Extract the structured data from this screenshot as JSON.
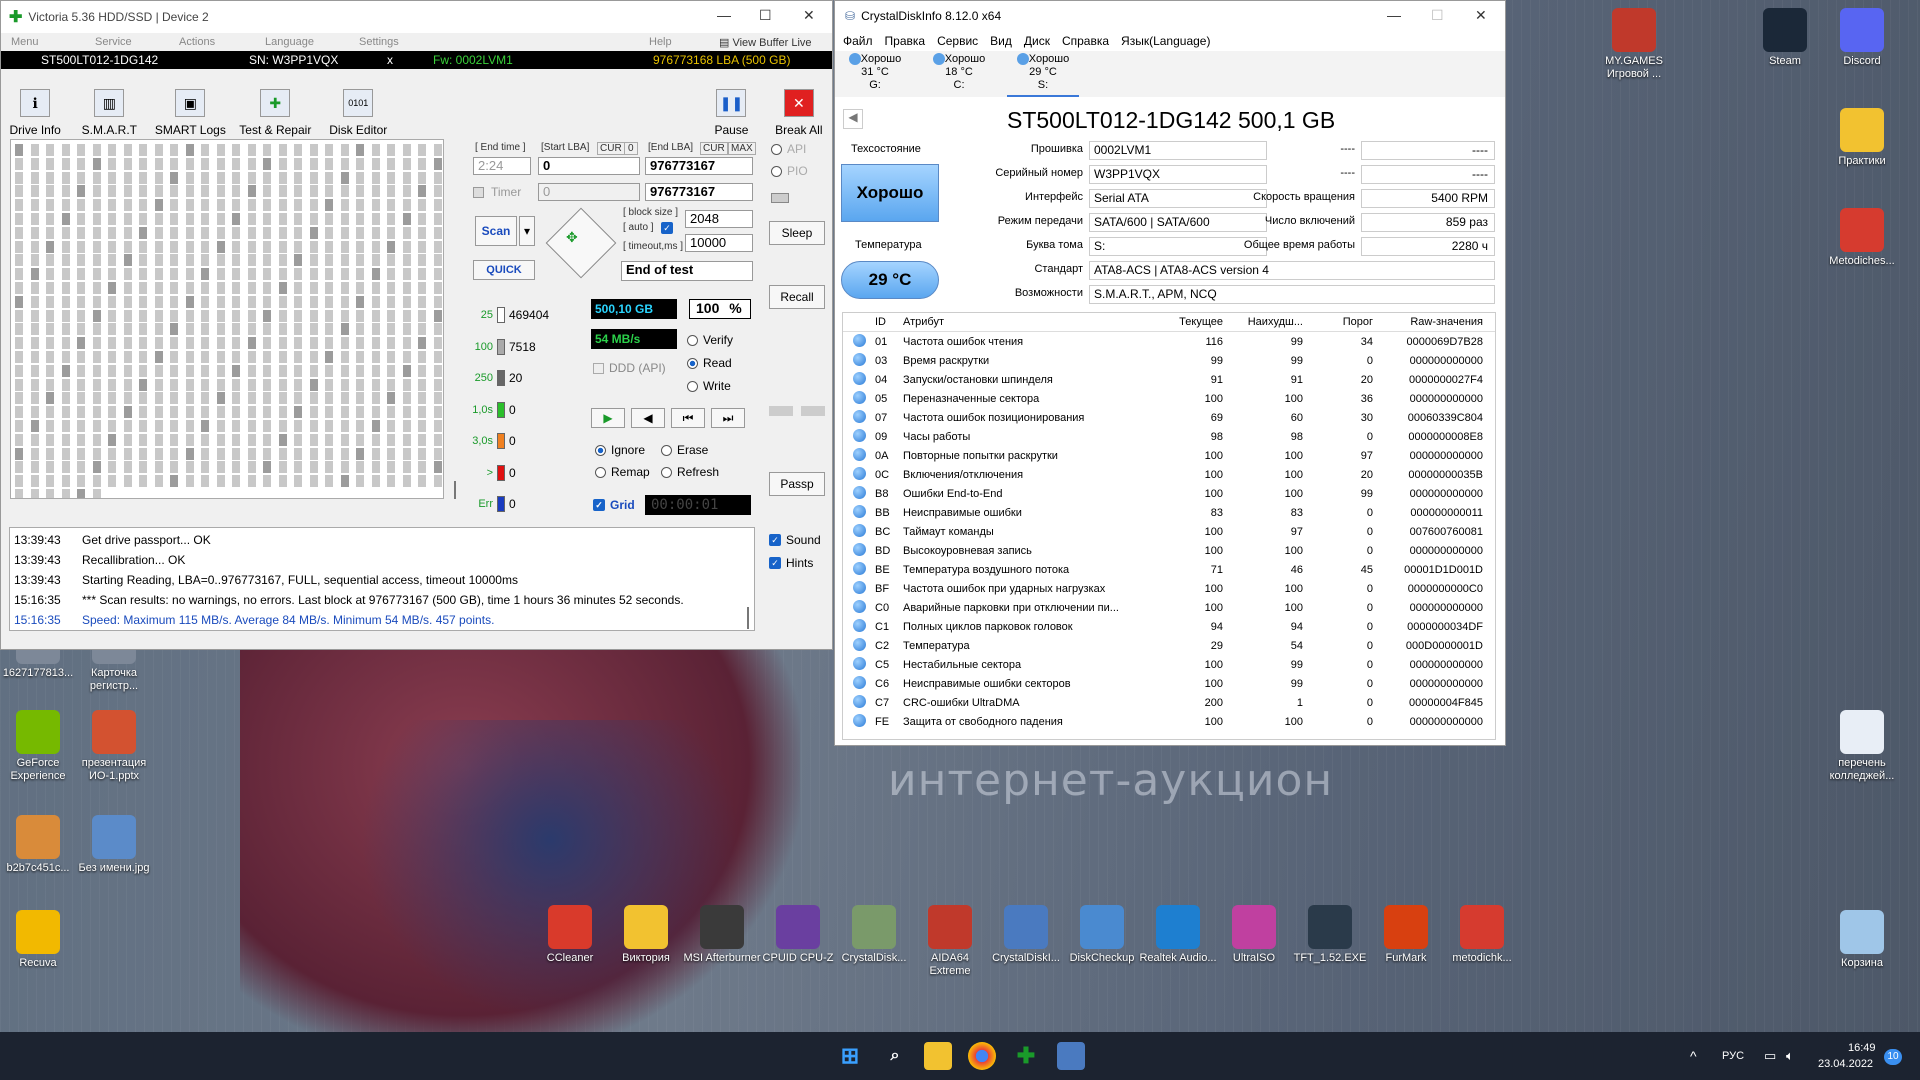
{
  "desktop": {
    "watermark": "интернет-аукцион",
    "icons_right": [
      {
        "label": "MY.GAMES Игровой ...",
        "color": "#c0392b"
      },
      {
        "label": "Steam",
        "color": "#1b2838"
      },
      {
        "label": "Discord",
        "color": "#5865f2"
      },
      {
        "label": "Практики",
        "color": "#f2c230"
      },
      {
        "label": "Metodiches...",
        "color": "#d63b2f"
      },
      {
        "label": "перечень колледжей...",
        "color": "#e8eef6"
      },
      {
        "label": "Корзина",
        "color": "#9fc6e8"
      }
    ],
    "icons_left": [
      {
        "label": "1627177813...",
        "color": "#7d8898"
      },
      {
        "label": "Карточка регистр...",
        "color": "#7d8898"
      },
      {
        "label": "GeForce Experience",
        "color": "#76b900"
      },
      {
        "label": "презентация ИО-1.pptx",
        "color": "#d35230"
      },
      {
        "label": "b2b7c451c...",
        "color": "#d98b3a"
      },
      {
        "label": "Без имени.jpg",
        "color": "#5b8bc9"
      },
      {
        "label": "Recuva",
        "color": "#f2b900"
      }
    ],
    "icons_bottom": [
      {
        "label": "CCleaner",
        "color": "#d93a2b"
      },
      {
        "label": "Виктория",
        "color": "#f2c230"
      },
      {
        "label": "MSI Afterburner",
        "color": "#3a3a3a"
      },
      {
        "label": "CPUID CPU-Z",
        "color": "#6a3fa0"
      },
      {
        "label": "CrystalDisk...",
        "color": "#7a9a6a"
      },
      {
        "label": "AIDA64 Extreme",
        "color": "#c0392b"
      },
      {
        "label": "CrystalDiskI...",
        "color": "#4a7ac0"
      },
      {
        "label": "DiskCheckup",
        "color": "#4a8ad0"
      },
      {
        "label": "Realtek Audio...",
        "color": "#1e7fd0"
      },
      {
        "label": "UltraISO",
        "color": "#c040a0"
      },
      {
        "label": "TFT_1.52.EXE",
        "color": "#2a3a4a"
      },
      {
        "label": "FurMark",
        "color": "#d84010"
      },
      {
        "label": "metodichk...",
        "color": "#d63b2f"
      }
    ]
  },
  "victoria": {
    "title": "Victoria 5.36 HDD/SSD | Device 2",
    "menu": [
      "Menu",
      "Service",
      "Actions",
      "Language",
      "Settings",
      "Help"
    ],
    "view_buffer": "View Buffer Live",
    "model": "ST500LT012-1DG142",
    "serial": "SN: W3PP1VQX",
    "close_x": "x",
    "firmware": "Fw: 0002LVM1",
    "lba": "976773168 LBA (500 GB)",
    "toolbar": [
      "Drive Info",
      "S.M.A.R.T",
      "SMART Logs",
      "Test & Repair",
      "Disk Editor"
    ],
    "pause": "Pause",
    "break_all": "Break All",
    "end_time_lbl": "[ End time ]",
    "start_lba_lbl": "[Start LBA]",
    "cur": "CUR",
    "zero": "0",
    "end_lba_lbl": "[End LBA]",
    "max": "MAX",
    "end_time": "2:24",
    "start_lba": "0",
    "end_lba": "976773167",
    "timer_lbl": "Timer",
    "timer_val": "0",
    "end_lba2": "976773167",
    "scan": "Scan",
    "quick": "QUICK",
    "block_size_lbl": "[ block size ]",
    "auto_lbl": "[ auto ]",
    "block_size": "2048",
    "timeout_lbl": "[ timeout,ms ]",
    "timeout": "10000",
    "end_of_test": "End of test",
    "api": "API",
    "pio": "PIO",
    "sleep": "Sleep",
    "recall": "Recall",
    "passp": "Passp",
    "counters": [
      {
        "label": "25",
        "value": "469404",
        "color": "#ffffff"
      },
      {
        "label": "100",
        "value": "7518",
        "color": "#aaaaaa"
      },
      {
        "label": "250",
        "value": "20",
        "color": "#666666"
      },
      {
        "label": "1,0s",
        "value": "0",
        "color": "#2bbf2b"
      },
      {
        "label": "3,0s",
        "value": "0",
        "color": "#f08020"
      },
      {
        "label": ">",
        "value": "0",
        "color": "#e01010"
      },
      {
        "label": "Err",
        "value": "0",
        "color": "#1a3cc0"
      }
    ],
    "size": "500,10 GB",
    "percent": "100",
    "percent_sign": "%",
    "speed": "54 MB/s",
    "ddd": "DDD (API)",
    "verify": "Verify",
    "read": "Read",
    "write": "Write",
    "ignore": "Ignore",
    "erase": "Erase",
    "remap": "Remap",
    "refresh": "Refresh",
    "grid": "Grid",
    "clock": "00:00:01",
    "sound": "Sound",
    "hints": "Hints",
    "log": [
      {
        "time": "13:39:43",
        "text": "Get drive passport... OK",
        "blue": false
      },
      {
        "time": "13:39:43",
        "text": "Recallibration... OK",
        "blue": false
      },
      {
        "time": "13:39:43",
        "text": "Starting Reading, LBA=0..976773167, FULL, sequential access, timeout 10000ms",
        "blue": false
      },
      {
        "time": "15:16:35",
        "text": "*** Scan results: no warnings, no errors. Last block at 976773167 (500 GB), time 1 hours 36 minutes 52 seconds.",
        "blue": false
      },
      {
        "time": "15:16:35",
        "text": "Speed: Maximum 115 MB/s. Average 84 MB/s. Minimum 54 MB/s. 457 points.",
        "blue": true
      }
    ]
  },
  "crystal": {
    "title": "CrystalDiskInfo 8.12.0 x64",
    "menu": [
      "Файл",
      "Правка",
      "Сервис",
      "Вид",
      "Диск",
      "Справка",
      "Язык(Language)"
    ],
    "disks": [
      {
        "status": "Хорошо",
        "temp": "31 °C",
        "letter": "G:"
      },
      {
        "status": "Хорошо",
        "temp": "18 °C",
        "letter": "C:"
      },
      {
        "status": "Хорошо",
        "temp": "29 °C",
        "letter": "S:"
      }
    ],
    "drive_title": "ST500LT012-1DG142 500,1 GB",
    "health_lbl": "Техсостояние",
    "health": "Хорошо",
    "temp_lbl": "Температура",
    "temp": "29 °C",
    "fw_lbl": "Прошивка",
    "fw": "0002LVM1",
    "sn_lbl": "Серийный номер",
    "sn": "W3PP1VQX",
    "iface_lbl": "Интерфейс",
    "iface": "Serial ATA",
    "mode_lbl": "Режим передачи",
    "mode": "SATA/600 | SATA/600",
    "letter_lbl": "Буква тома",
    "letter": "S:",
    "std_lbl": "Стандарт",
    "std": "ATA8-ACS | ATA8-ACS version 4",
    "feat_lbl": "Возможности",
    "feat": "S.M.A.R.T., APM, NCQ",
    "dash": "----",
    "rpm_lbl": "Скорость вращения",
    "rpm": "5400 RPM",
    "pc_lbl": "Число включений",
    "pc": "859 раз",
    "hours_lbl": "Общее время работы",
    "hours": "2280 ч",
    "headers": {
      "id": "ID",
      "attr": "Атрибут",
      "cur": "Текущее",
      "worst": "Наихудш...",
      "thr": "Порог",
      "raw": "Raw-значения"
    },
    "rows": [
      {
        "id": "01",
        "name": "Частота ошибок чтения",
        "cur": "116",
        "worst": "99",
        "thr": "34",
        "raw": "0000069D7B28"
      },
      {
        "id": "03",
        "name": "Время раскрутки",
        "cur": "99",
        "worst": "99",
        "thr": "0",
        "raw": "000000000000"
      },
      {
        "id": "04",
        "name": "Запуски/остановки шпинделя",
        "cur": "91",
        "worst": "91",
        "thr": "20",
        "raw": "0000000027F4"
      },
      {
        "id": "05",
        "name": "Переназначенные сектора",
        "cur": "100",
        "worst": "100",
        "thr": "36",
        "raw": "000000000000"
      },
      {
        "id": "07",
        "name": "Частота ошибок позиционирования",
        "cur": "69",
        "worst": "60",
        "thr": "30",
        "raw": "00060339C804"
      },
      {
        "id": "09",
        "name": "Часы работы",
        "cur": "98",
        "worst": "98",
        "thr": "0",
        "raw": "0000000008E8"
      },
      {
        "id": "0A",
        "name": "Повторные попытки раскрутки",
        "cur": "100",
        "worst": "100",
        "thr": "97",
        "raw": "000000000000"
      },
      {
        "id": "0C",
        "name": "Включения/отключения",
        "cur": "100",
        "worst": "100",
        "thr": "20",
        "raw": "00000000035B"
      },
      {
        "id": "B8",
        "name": "Ошибки End-to-End",
        "cur": "100",
        "worst": "100",
        "thr": "99",
        "raw": "000000000000"
      },
      {
        "id": "BB",
        "name": "Неисправимые ошибки",
        "cur": "83",
        "worst": "83",
        "thr": "0",
        "raw": "000000000011"
      },
      {
        "id": "BC",
        "name": "Таймаут команды",
        "cur": "100",
        "worst": "97",
        "thr": "0",
        "raw": "007600760081"
      },
      {
        "id": "BD",
        "name": "Высокоуровневая запись",
        "cur": "100",
        "worst": "100",
        "thr": "0",
        "raw": "000000000000"
      },
      {
        "id": "BE",
        "name": "Температура воздушного потока",
        "cur": "71",
        "worst": "46",
        "thr": "45",
        "raw": "00001D1D001D"
      },
      {
        "id": "BF",
        "name": "Частота ошибок при ударных нагрузках",
        "cur": "100",
        "worst": "100",
        "thr": "0",
        "raw": "0000000000C0"
      },
      {
        "id": "C0",
        "name": "Аварийные парковки при отключении пи...",
        "cur": "100",
        "worst": "100",
        "thr": "0",
        "raw": "000000000000"
      },
      {
        "id": "C1",
        "name": "Полных циклов парковок головок",
        "cur": "94",
        "worst": "94",
        "thr": "0",
        "raw": "0000000034DF"
      },
      {
        "id": "C2",
        "name": "Температура",
        "cur": "29",
        "worst": "54",
        "thr": "0",
        "raw": "000D0000001D"
      },
      {
        "id": "C5",
        "name": "Нестабильные сектора",
        "cur": "100",
        "worst": "99",
        "thr": "0",
        "raw": "000000000000"
      },
      {
        "id": "C6",
        "name": "Неисправимые ошибки секторов",
        "cur": "100",
        "worst": "99",
        "thr": "0",
        "raw": "000000000000"
      },
      {
        "id": "C7",
        "name": "CRC-ошибки UltraDMA",
        "cur": "200",
        "worst": "1",
        "thr": "0",
        "raw": "00000004F845"
      },
      {
        "id": "FE",
        "name": "Защита от свободного падения",
        "cur": "100",
        "worst": "100",
        "thr": "0",
        "raw": "000000000000"
      }
    ]
  },
  "taskbar": {
    "lang": "РУС",
    "time": "16:49",
    "date": "23.04.2022",
    "badge": "10"
  }
}
